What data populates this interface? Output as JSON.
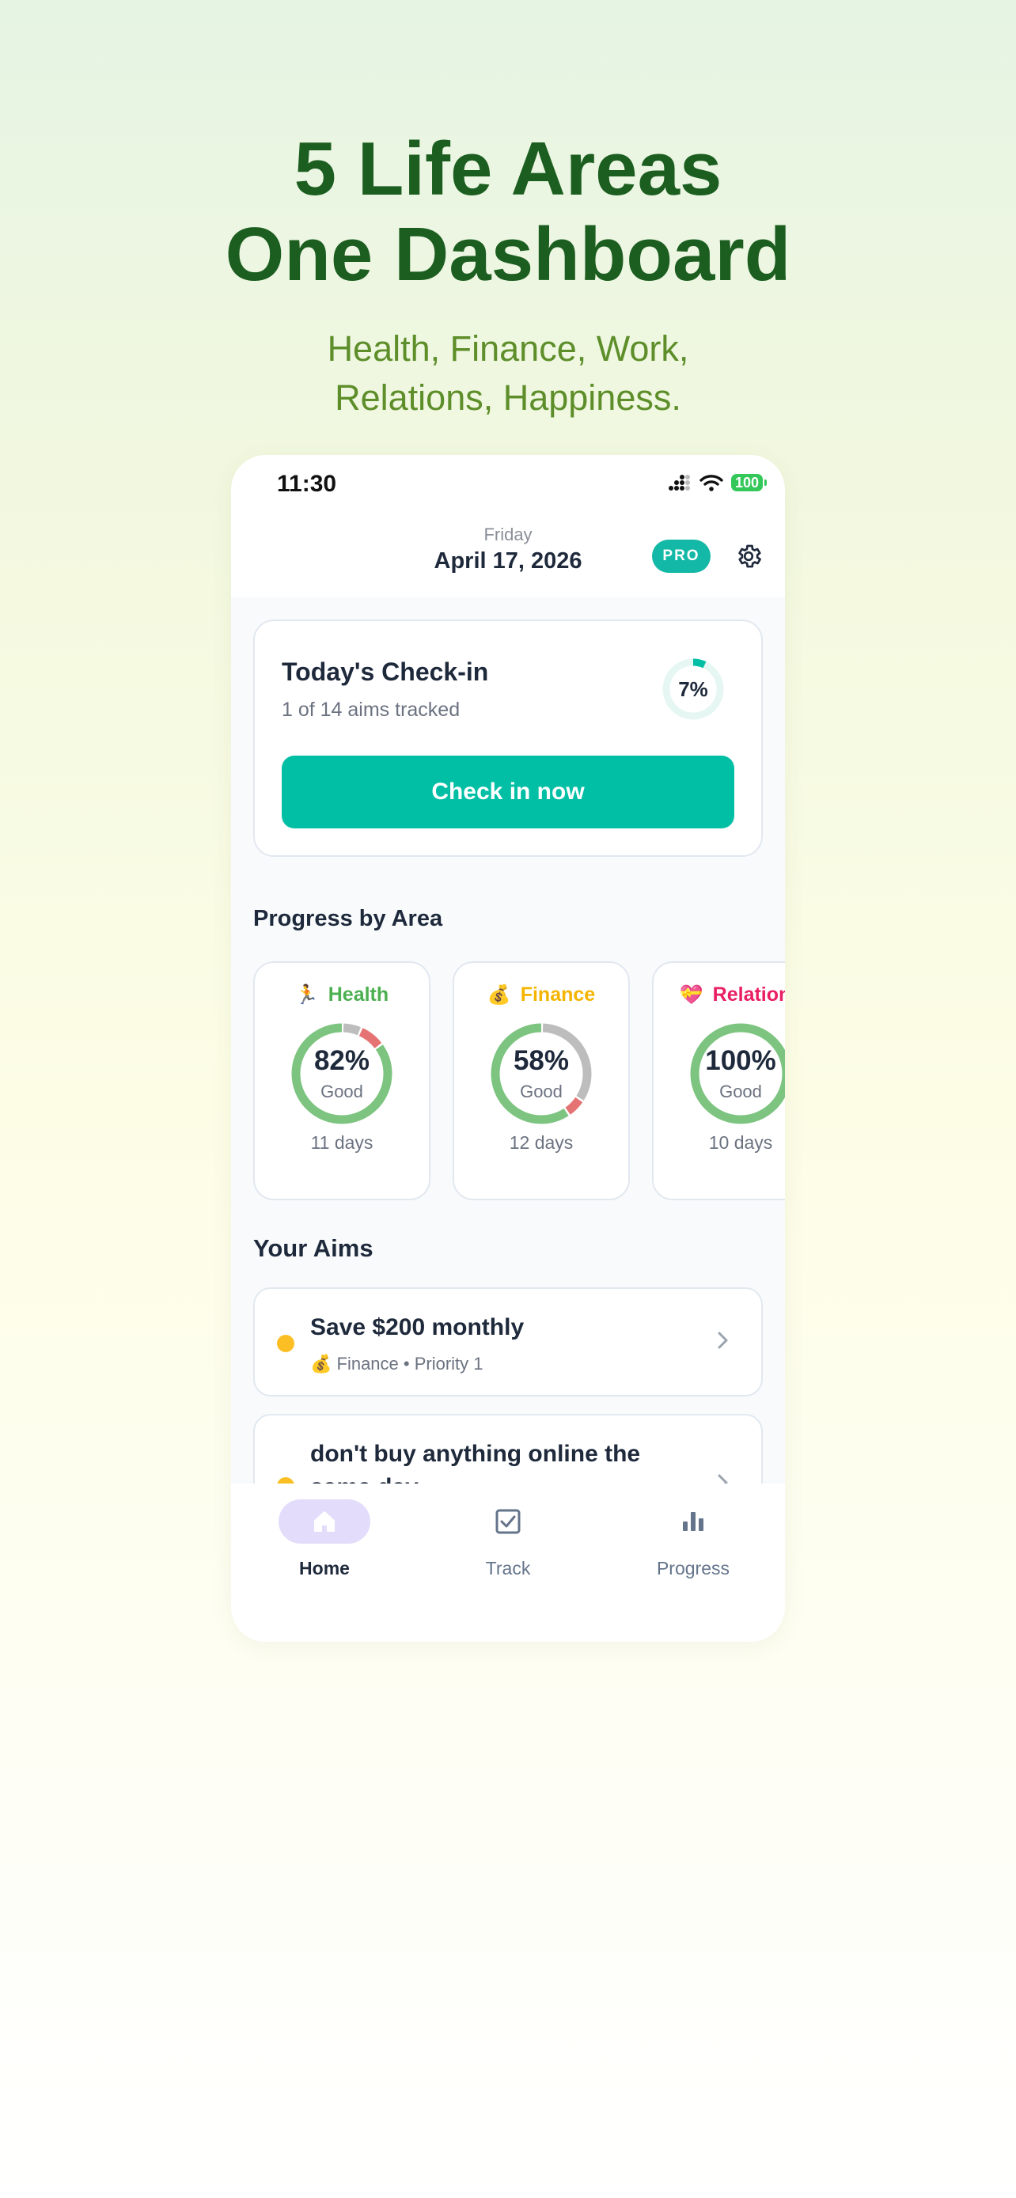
{
  "hero": {
    "title_line1": "5 Life Areas",
    "title_line2": "One Dashboard",
    "subtitle_line1": "Health, Finance, Work,",
    "subtitle_line2": "Relations, Happiness."
  },
  "status_bar": {
    "time": "11:30",
    "battery": "100"
  },
  "header": {
    "day": "Friday",
    "date": "April 17, 2026",
    "badge": "PRO",
    "settings_icon": "gear-icon"
  },
  "checkin": {
    "title": "Today's Check-in",
    "subtitle": "1 of 14 aims tracked",
    "percent_label": "7%",
    "percent": 7,
    "button_label": "Check in now",
    "accent": "#00bfa5"
  },
  "areas": {
    "section_title": "Progress by Area",
    "items": [
      {
        "emoji": "🏃",
        "name": "Health",
        "color": "#4caf50",
        "percent_label": "82%",
        "percent": 82,
        "status": "Good",
        "days": "11 days",
        "segments": [
          82,
          8,
          6
        ]
      },
      {
        "emoji": "💰",
        "name": "Finance",
        "color": "#f4b400",
        "percent_label": "58%",
        "percent": 58,
        "status": "Good",
        "days": "12 days",
        "segments": [
          58,
          6,
          33
        ]
      },
      {
        "emoji": "💝",
        "name": "Relations",
        "color": "#e91e63",
        "percent_label": "100%",
        "percent": 100,
        "status": "Good",
        "days": "10 days",
        "segments": [
          100,
          0,
          0
        ]
      }
    ]
  },
  "aims": {
    "section_title": "Your Aims",
    "items": [
      {
        "title": "Save $200 monthly",
        "meta": "💰  Finance • Priority 1",
        "status_color": "#fbbf24"
      },
      {
        "title": "don't buy anything online the",
        "title_line2": "same day",
        "status_color": "#fbbf24"
      }
    ]
  },
  "tabs": [
    {
      "label": "Home",
      "icon": "home-icon",
      "active": true
    },
    {
      "label": "Track",
      "icon": "checkbox-icon",
      "active": false
    },
    {
      "label": "Progress",
      "icon": "bar-chart-icon",
      "active": false
    }
  ]
}
